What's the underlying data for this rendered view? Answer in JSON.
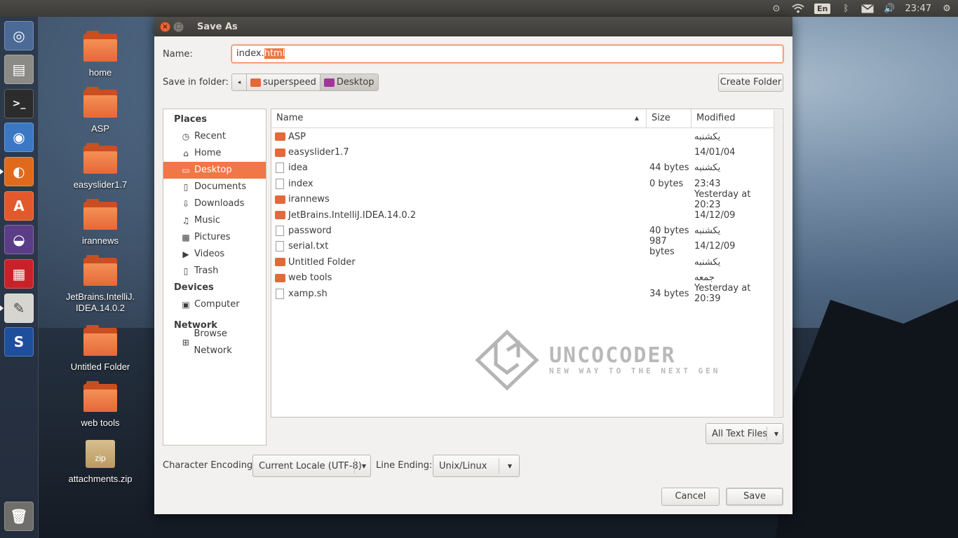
{
  "top_panel": {
    "lang": "En",
    "time": "23:47"
  },
  "desktop_icons": [
    {
      "label": "home",
      "kind": "folder"
    },
    {
      "label": "ASP",
      "kind": "folder"
    },
    {
      "label": "easyslider1.7",
      "kind": "folder"
    },
    {
      "label": "irannews",
      "kind": "folder"
    },
    {
      "label": "JetBrains.IntelliJ.\nIDEA.14.0.2",
      "kind": "folder"
    },
    {
      "label": "Untitled Folder",
      "kind": "folder"
    },
    {
      "label": "web tools",
      "kind": "folder"
    },
    {
      "label": "attachments.zip",
      "kind": "zip",
      "badge": "zip"
    }
  ],
  "dialog": {
    "title": "Save As",
    "name_label": "Name:",
    "name_value_base": "index.",
    "name_value_ext": "html",
    "save_in_label": "Save in folder:",
    "crumbs": [
      "superspeed",
      "Desktop"
    ],
    "create_folder": "Create Folder",
    "places": {
      "header": "Places",
      "items": [
        "Recent",
        "Home",
        "Desktop",
        "Documents",
        "Downloads",
        "Music",
        "Pictures",
        "Videos",
        "Trash"
      ],
      "devices_header": "Devices",
      "devices": [
        "Computer"
      ],
      "network_header": "Network",
      "network": [
        "Browse Network"
      ]
    },
    "columns": {
      "name": "Name",
      "size": "Size",
      "modified": "Modified"
    },
    "files": [
      {
        "name": "ASP",
        "kind": "folder",
        "size": "",
        "modified": "یکشنبه"
      },
      {
        "name": "easyslider1.7",
        "kind": "folder",
        "size": "",
        "modified": "14/01/04"
      },
      {
        "name": "idea",
        "kind": "file",
        "size": "44 bytes",
        "modified": "یکشنبه"
      },
      {
        "name": "index",
        "kind": "file",
        "size": "0 bytes",
        "modified": "23:43"
      },
      {
        "name": "irannews",
        "kind": "folder",
        "size": "",
        "modified": "Yesterday at 20:23"
      },
      {
        "name": "JetBrains.IntelliJ.IDEA.14.0.2",
        "kind": "folder",
        "size": "",
        "modified": "14/12/09"
      },
      {
        "name": "password",
        "kind": "file",
        "size": "40 bytes",
        "modified": "یکشنبه"
      },
      {
        "name": "serial.txt",
        "kind": "file",
        "size": "987 bytes",
        "modified": "14/12/09"
      },
      {
        "name": "Untitled Folder",
        "kind": "folder",
        "size": "",
        "modified": "یکشنبه"
      },
      {
        "name": "web tools",
        "kind": "folder",
        "size": "",
        "modified": "جمعه"
      },
      {
        "name": "xamp.sh",
        "kind": "script",
        "size": "34 bytes",
        "modified": "Yesterday at 20:39"
      }
    ],
    "watermark": {
      "title": "UNCOCODER",
      "subtitle": "NEW WAY TO THE NEXT GEN"
    },
    "filter": "All Text Files",
    "encoding_label": "Character Encoding:",
    "encoding_value": "Current Locale (UTF-8)",
    "line_ending_label": "Line Ending:",
    "line_ending_value": "Unix/Linux",
    "cancel": "Cancel",
    "save": "Save"
  }
}
